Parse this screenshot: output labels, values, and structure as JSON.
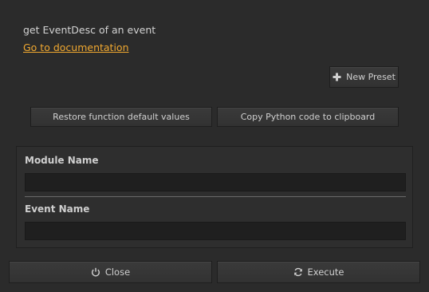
{
  "header": {
    "description": "get EventDesc of an event",
    "doc_link": "Go to documentation"
  },
  "toolbar": {
    "new_preset_label": "New Preset",
    "new_preset_icon": "plus-icon",
    "restore_label": "Restore function default values",
    "copy_label": "Copy Python code to clipboard"
  },
  "form": {
    "module_name_label": "Module Name",
    "module_name_value": "",
    "event_name_label": "Event Name",
    "event_name_value": ""
  },
  "footer": {
    "close_label": "Close",
    "close_icon": "power-icon",
    "execute_label": "Execute",
    "execute_icon": "refresh-icon"
  },
  "colors": {
    "background": "#2b2b2b",
    "link": "#f0a830",
    "input_bg": "#1f1f1f"
  }
}
